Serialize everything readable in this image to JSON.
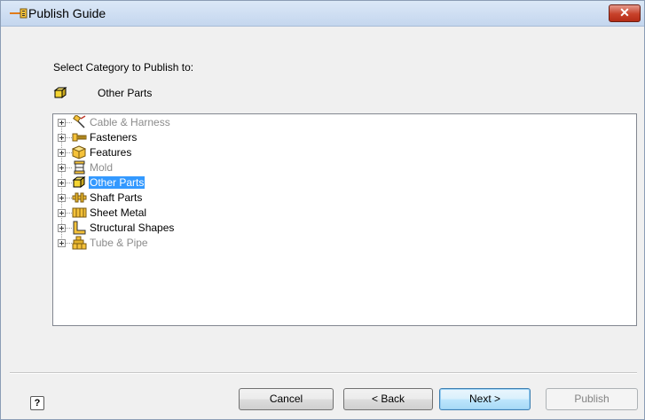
{
  "window": {
    "title": "Publish Guide",
    "close_label": "✕"
  },
  "main": {
    "prompt": "Select Category to Publish to:",
    "selected_category": "Other Parts"
  },
  "tree": {
    "items": [
      {
        "label": "Cable & Harness",
        "icon": "cable-harness-icon",
        "enabled": false,
        "selected": false
      },
      {
        "label": "Fasteners",
        "icon": "fasteners-icon",
        "enabled": true,
        "selected": false
      },
      {
        "label": "Features",
        "icon": "features-icon",
        "enabled": true,
        "selected": false
      },
      {
        "label": "Mold",
        "icon": "mold-icon",
        "enabled": false,
        "selected": false
      },
      {
        "label": "Other Parts",
        "icon": "other-parts-icon",
        "enabled": true,
        "selected": true
      },
      {
        "label": "Shaft Parts",
        "icon": "shaft-parts-icon",
        "enabled": true,
        "selected": false
      },
      {
        "label": "Sheet Metal",
        "icon": "sheet-metal-icon",
        "enabled": true,
        "selected": false
      },
      {
        "label": "Structural Shapes",
        "icon": "structural-shapes-icon",
        "enabled": true,
        "selected": false
      },
      {
        "label": "Tube & Pipe",
        "icon": "tube-pipe-icon",
        "enabled": false,
        "selected": false
      }
    ]
  },
  "footer": {
    "help_label": "?",
    "cancel_label": "Cancel",
    "back_label": "< Back",
    "next_label": "Next >",
    "publish_label": "Publish"
  },
  "colors": {
    "selection": "#3399ff",
    "disabled_text": "#8c8c8c",
    "close_button": "#c7412a"
  }
}
